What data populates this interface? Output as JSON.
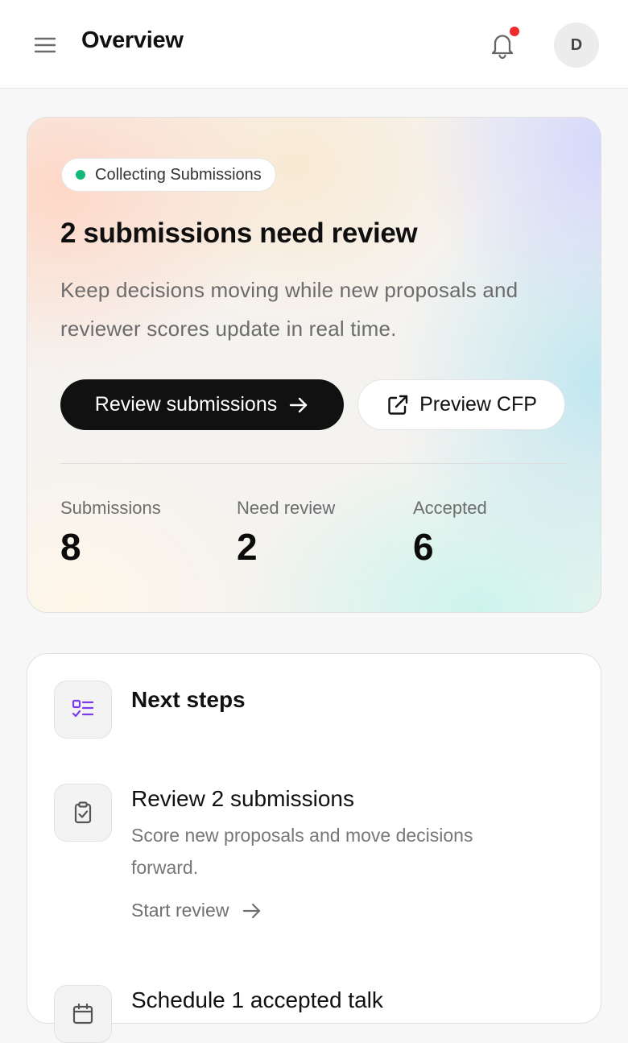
{
  "header": {
    "title": "Overview",
    "avatar_initial": "D",
    "icons": {
      "menu": "hamburger-icon",
      "notifications": "bell-icon"
    },
    "notification_dot_color": "#ef2b2b"
  },
  "hero": {
    "status_label": "Collecting Submissions",
    "status_color": "#14b87b",
    "title": "2 submissions need review",
    "description": "Keep decisions moving while new proposals and reviewer scores update in real time.",
    "primary_button": "Review submissions",
    "secondary_button": "Preview CFP",
    "stats": [
      {
        "label": "Submissions",
        "value": "8"
      },
      {
        "label": "Need review",
        "value": "2"
      },
      {
        "label": "Accepted",
        "value": "6"
      }
    ]
  },
  "next_steps": {
    "title": "Next steps",
    "icon": "checklist-icon",
    "accent_color": "#7c3aed",
    "items": [
      {
        "title": "Review 2 submissions",
        "description": "Score new proposals and move decisions forward.",
        "action": "Start review",
        "icon": "clipboard-check-icon"
      },
      {
        "title": "Schedule 1 accepted talk",
        "icon": "calendar-icon"
      }
    ]
  }
}
